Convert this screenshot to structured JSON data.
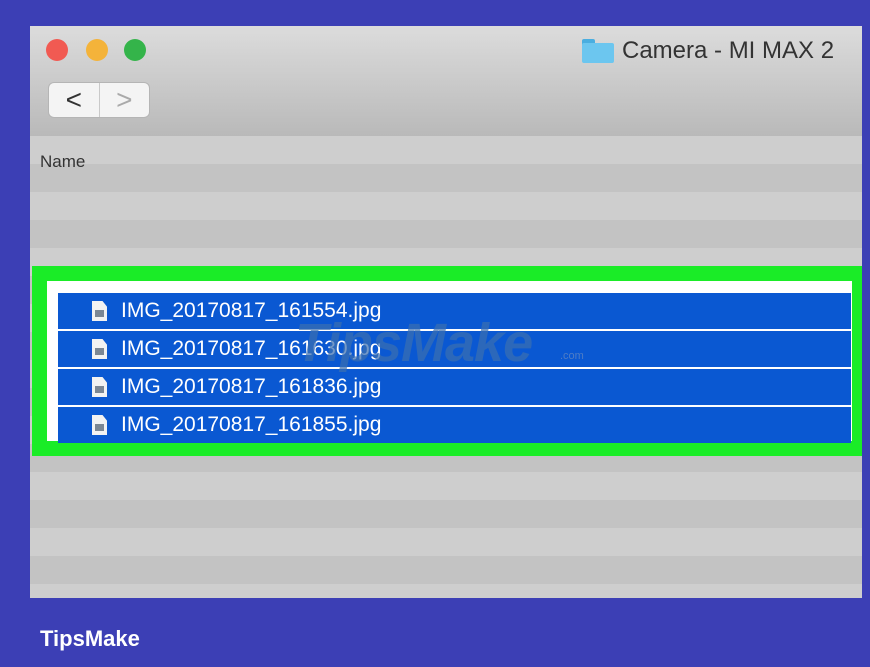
{
  "window": {
    "title": "Camera - MI MAX 2",
    "title_icon": "folder-icon",
    "nav": {
      "back_glyph": "<",
      "forward_glyph": ">"
    }
  },
  "list": {
    "column_header": "Name",
    "files": [
      {
        "name": "IMG_20170817_161554.jpg",
        "icon": "image-file-icon",
        "selected": true
      },
      {
        "name": "IMG_20170817_161630.jpg",
        "icon": "image-file-icon",
        "selected": true
      },
      {
        "name": "IMG_20170817_161836.jpg",
        "icon": "image-file-icon",
        "selected": true
      },
      {
        "name": "IMG_20170817_161855.jpg",
        "icon": "image-file-icon",
        "selected": true
      }
    ]
  },
  "watermark": {
    "text": "TipsMake",
    "subtext": ".com"
  },
  "branding": {
    "label": "TipsMake"
  },
  "colors": {
    "background": "#3c3fb5",
    "selection": "#0a58d2",
    "highlight_border": "#1aec27",
    "close": "#f15a52",
    "minimize": "#f4b33a",
    "maximize": "#34b44a"
  }
}
